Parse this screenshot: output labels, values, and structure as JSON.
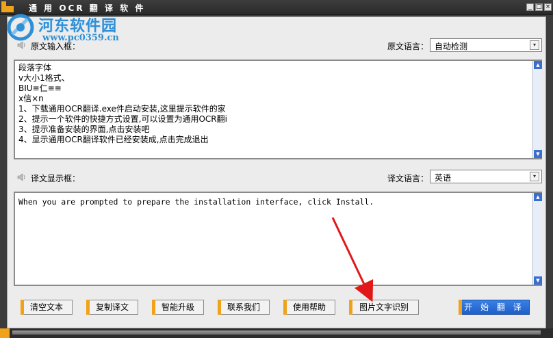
{
  "window": {
    "title": "通 用 OCR 翻 译 软 件",
    "controls": [
      "_",
      "□",
      "×"
    ]
  },
  "watermark": {
    "site_name": "河东软件园",
    "url": "www.pc0359.cn"
  },
  "source": {
    "box_label": "原文输入框：",
    "lang_label": "原文语言：",
    "lang_value": "自动检测",
    "text": "段落字体\nv大小1格式、\nBIU≡仁≡≡\nx信×n\n1、下载通用OCR翻译.exe件启动安装,这里提示软件的家\n2、提示一个软件的快捷方式设置,可以设置为通用OCR翻i\n3、提示准备安装的界面,点击安装吧\n4、显示通用OCR翻译软件已经安装成,点击完成退出"
  },
  "target": {
    "box_label": "译文显示框：",
    "lang_label": "译文语言：",
    "lang_value": "英语",
    "text": "When you are prompted to prepare the installation interface, click Install."
  },
  "buttons": {
    "clear": "清空文本",
    "copy": "复制译文",
    "upgrade": "智能升级",
    "contact": "联系我们",
    "help": "使用帮助",
    "image_ocr": "图片文字识别",
    "start": "开 始 翻 译"
  },
  "colors": {
    "accent_orange": "#f0a21a",
    "primary_blue": "#1e5fc8",
    "arrow_red": "#e01818",
    "watermark_blue": "#2f8fd6"
  },
  "icons": {
    "speaker": "speaker-icon",
    "dropdown": "dropdown-arrow-icon"
  }
}
